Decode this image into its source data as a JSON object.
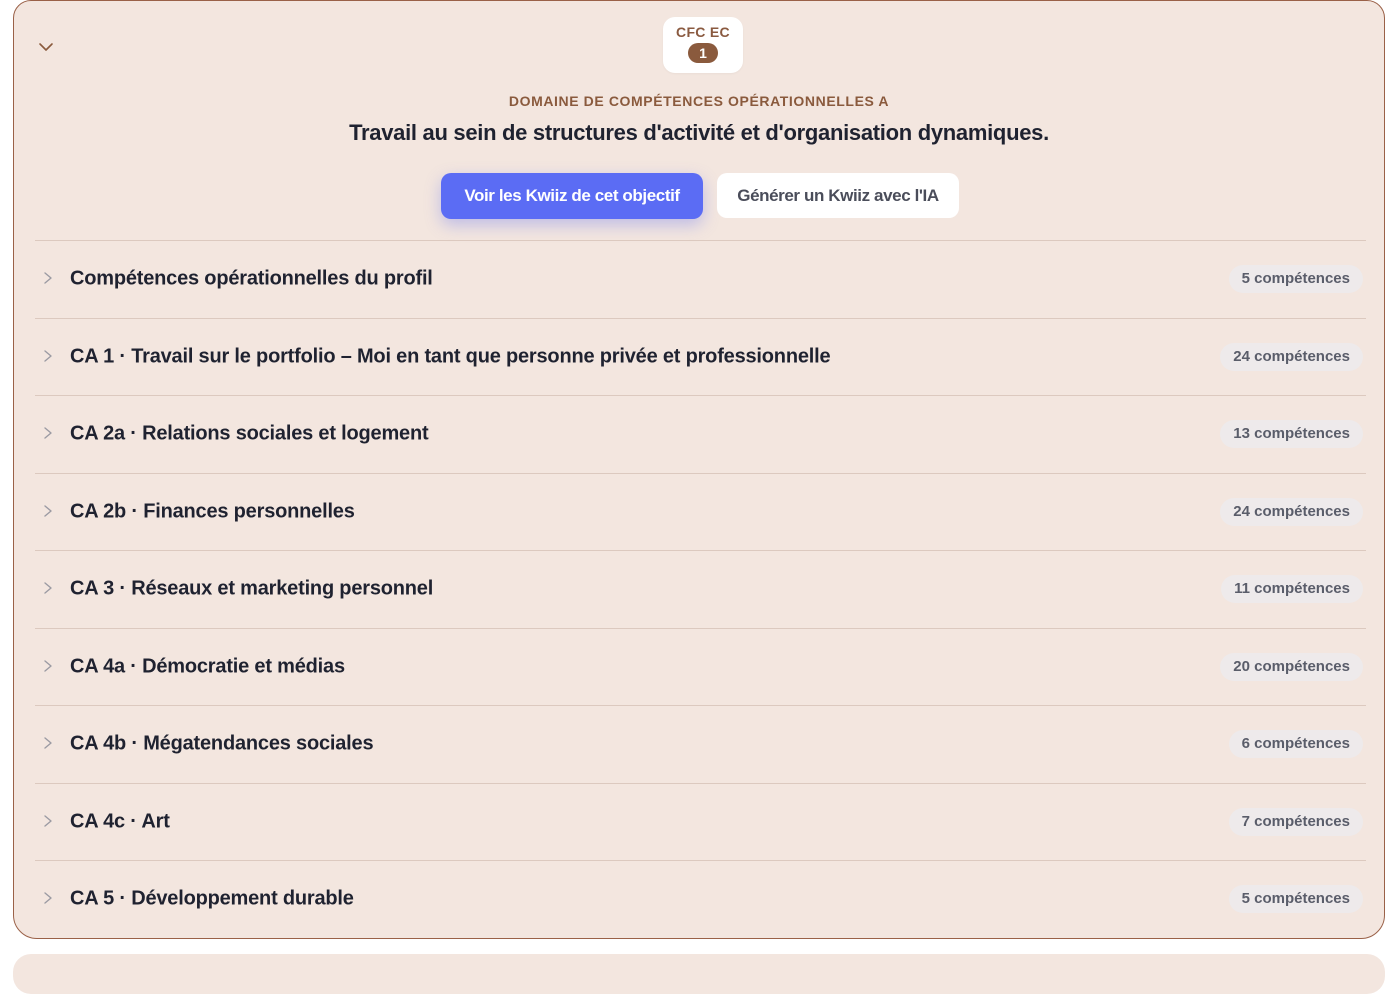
{
  "header": {
    "badge_code": "CFC EC",
    "badge_number": "1",
    "domain_label": "DOMAINE DE COMPÉTENCES OPÉRATIONNELLES A",
    "domain_title": "Travail au sein de structures d'activité et d'organisation dynamiques.",
    "primary_button": "Voir les Kwiiz de cet objectif",
    "secondary_button": "Générer un Kwiiz avec l'IA"
  },
  "items": [
    {
      "label": "Compétences opérationnelles du profil",
      "count": "5 compétences"
    },
    {
      "label": "CA 1 · Travail sur le portfolio – Moi en tant que personne privée et professionnelle",
      "count": "24 compétences"
    },
    {
      "label": "CA 2a · Relations sociales et logement",
      "count": "13 compétences"
    },
    {
      "label": "CA 2b · Finances personnelles",
      "count": "24 compétences"
    },
    {
      "label": "CA 3 · Réseaux et marketing personnel",
      "count": "11 compétences"
    },
    {
      "label": "CA 4a · Démocratie et médias",
      "count": "20 compétences"
    },
    {
      "label": "CA 4b · Mégatendances sociales",
      "count": "6 compétences"
    },
    {
      "label": "CA 4c · Art",
      "count": "7 compétences"
    },
    {
      "label": "CA 5 · Développement durable",
      "count": "5 compétences"
    }
  ],
  "colors": {
    "card_background": "#f3e6df",
    "card_border": "#9a6148",
    "accent_brown": "#8a5a3d",
    "primary_button": "#5b6cf4"
  },
  "icons": {
    "collapse": "chevron-down-icon",
    "row_expand": "chevron-right-icon"
  }
}
